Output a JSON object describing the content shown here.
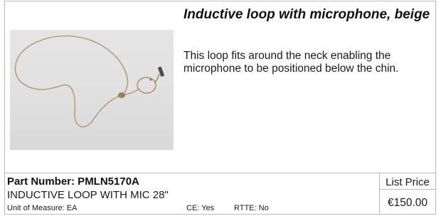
{
  "product": {
    "title": "Inductive loop with microphone, beige",
    "description": "This loop fits around the neck enabling the microphone to be positioned below the chin.",
    "image_subject": "beige inductive neck loop with microphone"
  },
  "details": {
    "part_number": "Part Number: PMLN5170A",
    "part_description": "INDUCTIVE LOOP WITH MIC 28\"",
    "unit_of_measure": "Unit of Measure: EA",
    "ce": "CE: Yes",
    "rtte": "RTTE: No"
  },
  "pricing": {
    "label": "List Price",
    "value": "€150.00"
  },
  "colors": {
    "border": "#b9b9b9",
    "text": "#1a1a1a",
    "cable": "#b79c78"
  }
}
